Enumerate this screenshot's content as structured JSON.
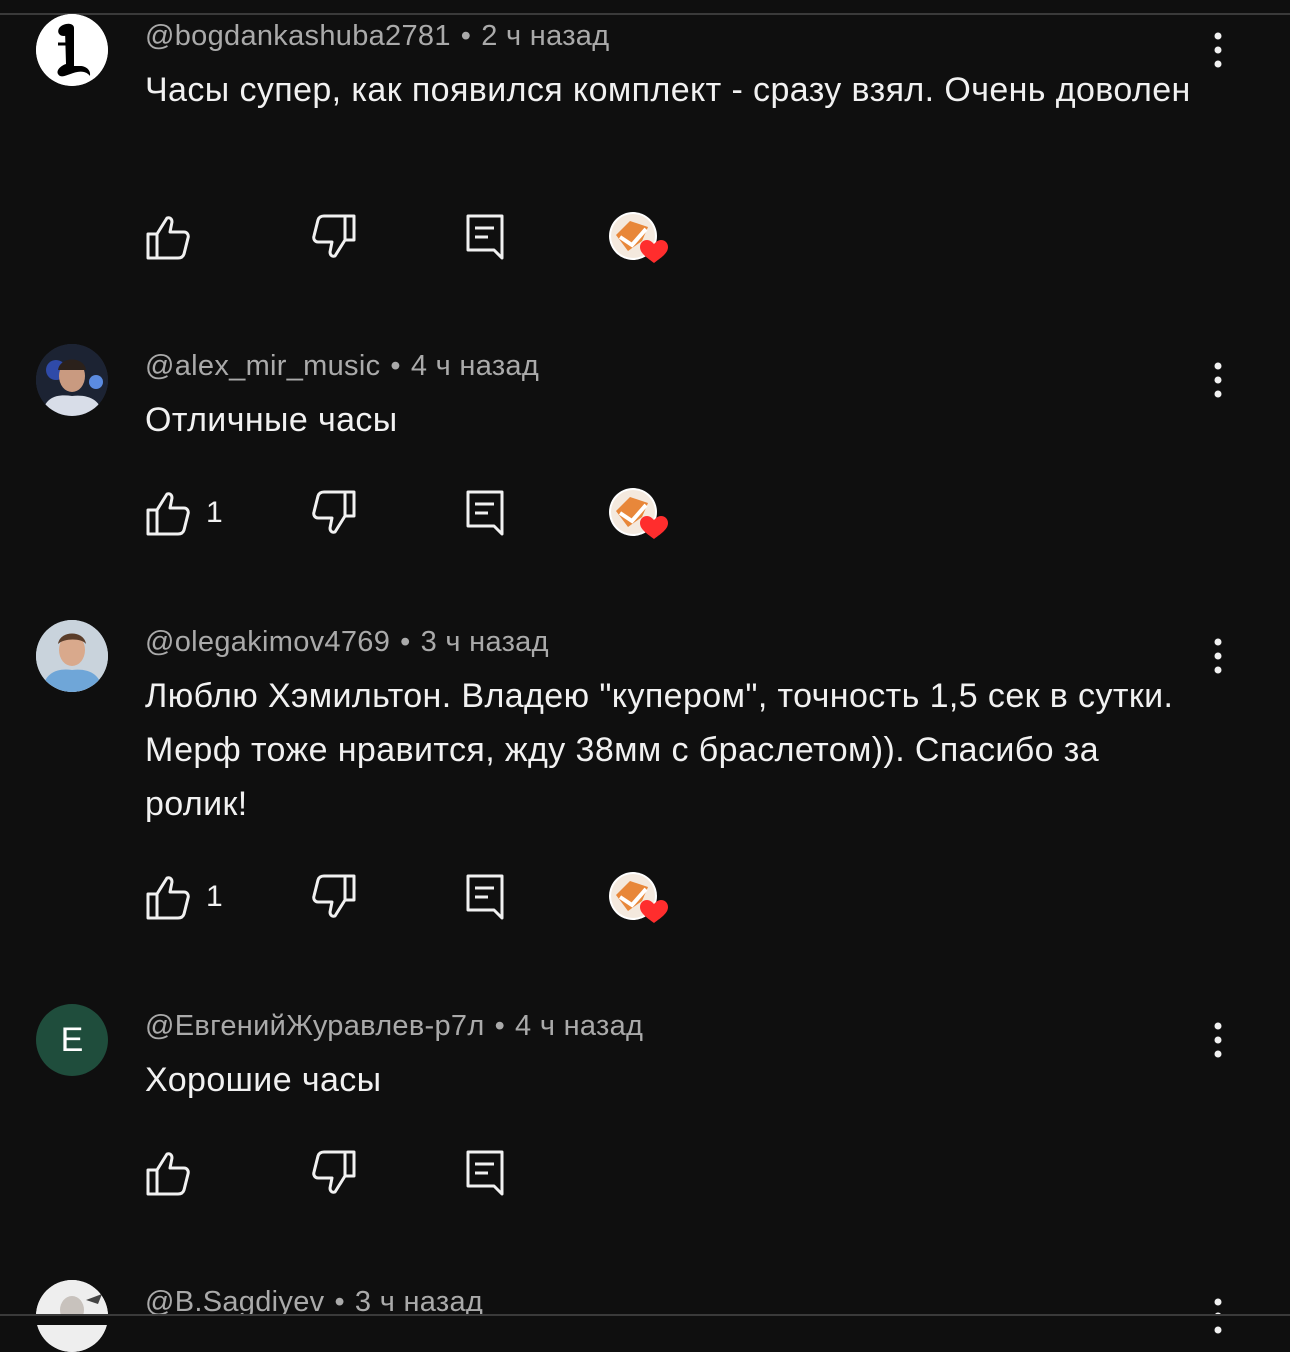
{
  "comments": [
    {
      "author": "@bogdankashuba2781",
      "time": "2 ч назад",
      "text": "Часы супер, как появился комплект - сразу взял. Очень доволен",
      "likes": "",
      "avatar": {
        "type": "logo-L"
      },
      "hearted": true
    },
    {
      "author": "@alex_mir_music",
      "time": "4 ч назад",
      "text": "Отличные часы",
      "likes": "1",
      "avatar": {
        "type": "photo"
      },
      "hearted": true
    },
    {
      "author": "@olegakimov4769",
      "time": "3 ч назад",
      "text": "Люблю Хэмильтон.  Владею \"купером\", точность 1,5 сек в сутки. Мерф тоже нравится, жду 38мм с браслетом)). Спасибо за ролик!",
      "likes": "1",
      "avatar": {
        "type": "photo"
      },
      "hearted": true
    },
    {
      "author": "@ЕвгенийЖуравлев-р7л",
      "time": "4 ч назад",
      "text": "Хорошие часы",
      "likes": "",
      "avatar": {
        "type": "letter",
        "letter": "Е",
        "color": "#1f4d3c"
      },
      "hearted": false
    },
    {
      "author": "@B.Sagdiyev",
      "time": "3 ч назад",
      "text": "",
      "likes": "",
      "avatar": {
        "type": "photo"
      },
      "hearted": false
    }
  ],
  "separator": "•",
  "colors": {
    "background": "#0f0f0f",
    "text": "#f1f1f1",
    "meta": "#aaaaaa",
    "heart": "#ff2d2d",
    "creator_avatar": "#e8873a"
  }
}
